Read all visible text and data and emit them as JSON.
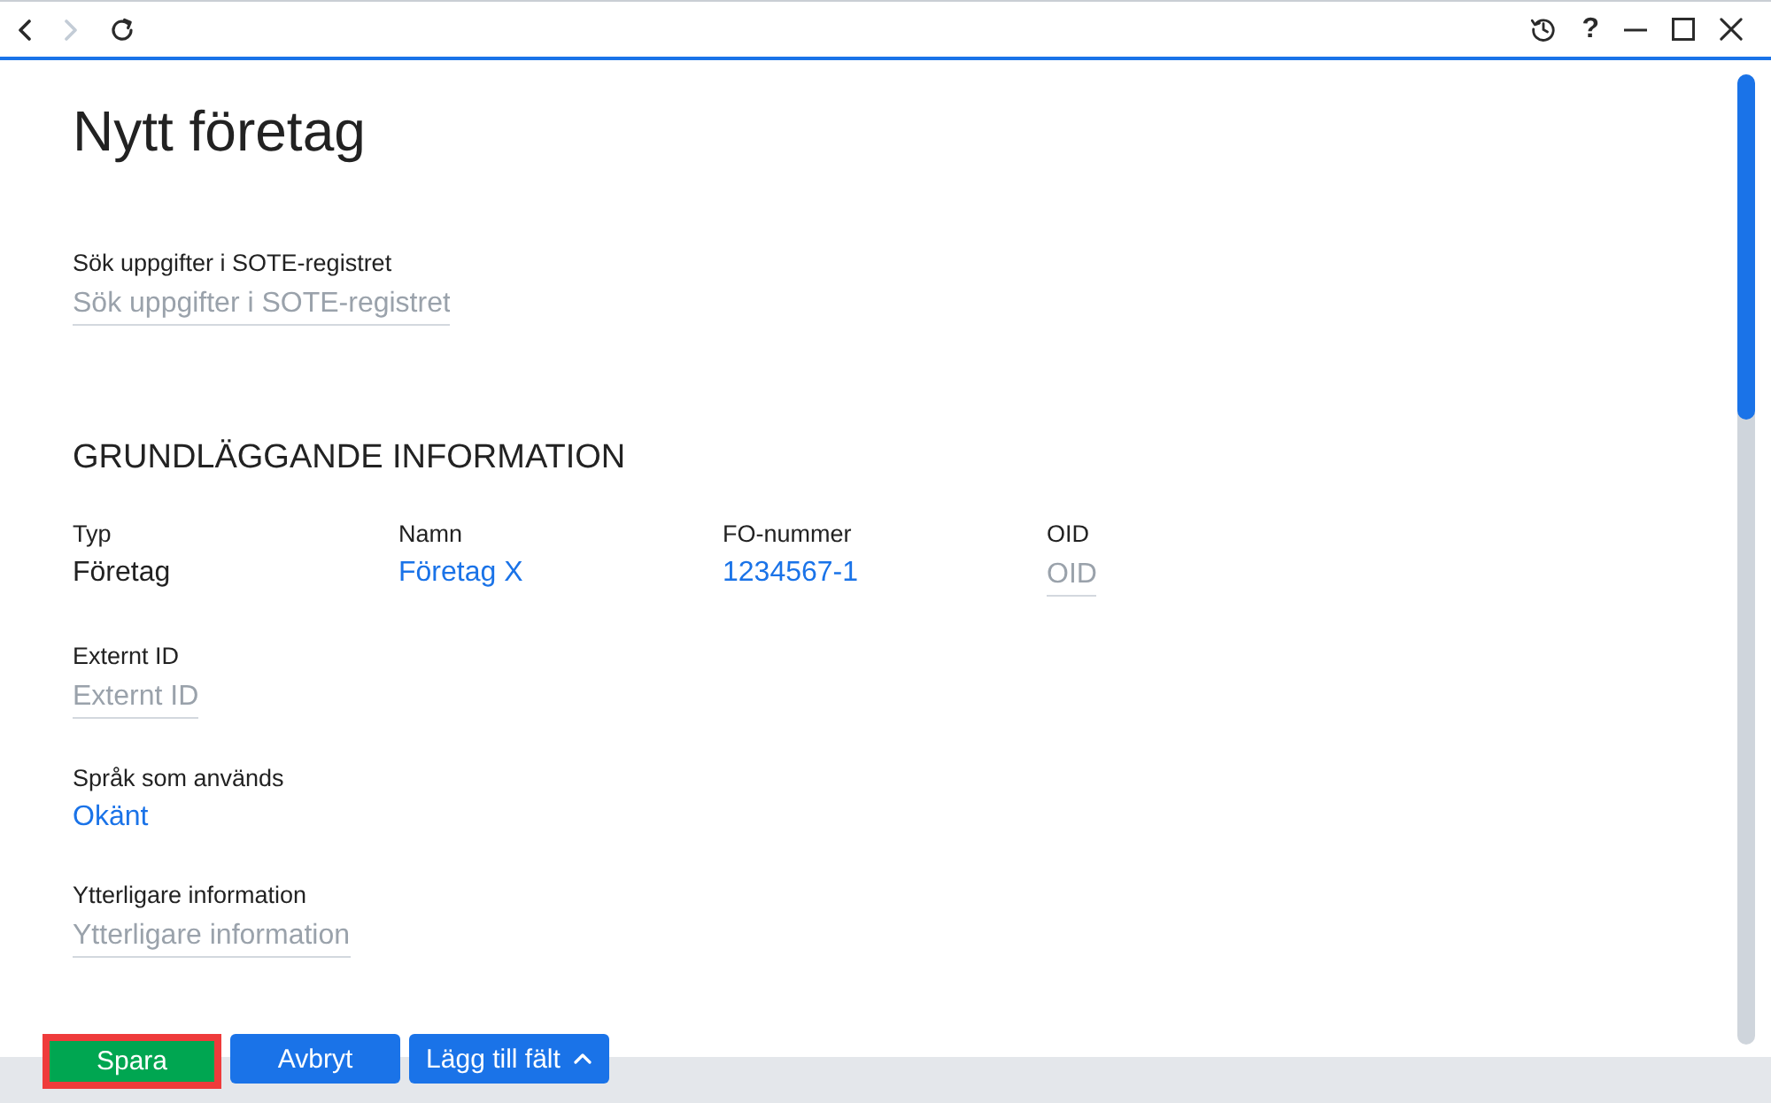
{
  "toolbar": {
    "back_disabled": false,
    "forward_disabled": true,
    "help_label": "?"
  },
  "page": {
    "title": "Nytt företag",
    "search": {
      "label": "Sök uppgifter i SOTE-registret",
      "placeholder": "Sök uppgifter i SOTE-registret"
    },
    "section": {
      "title": "GRUNDLÄGGANDE INFORMATION",
      "row": [
        {
          "kind": "text",
          "label": "Typ",
          "value": "Företag"
        },
        {
          "kind": "link",
          "label": "Namn",
          "value": "Företag X"
        },
        {
          "kind": "link",
          "label": "FO-nummer",
          "value": "1234567-1"
        },
        {
          "kind": "input",
          "label": "OID",
          "placeholder": "OID"
        }
      ],
      "fields": [
        {
          "kind": "input",
          "label": "Externt ID",
          "placeholder": "Externt ID"
        },
        {
          "kind": "link",
          "label": "Språk som används",
          "value": "Okänt"
        },
        {
          "kind": "input",
          "label": "Ytterligare information",
          "placeholder": "Ytterligare information"
        }
      ]
    }
  },
  "buttons": [
    {
      "kind": "primary",
      "label": "Spara",
      "highlighted": true
    },
    {
      "kind": "secondary",
      "label": "Avbryt",
      "highlighted": false
    },
    {
      "kind": "menu",
      "label": "Lägg till fält",
      "highlighted": false
    }
  ]
}
